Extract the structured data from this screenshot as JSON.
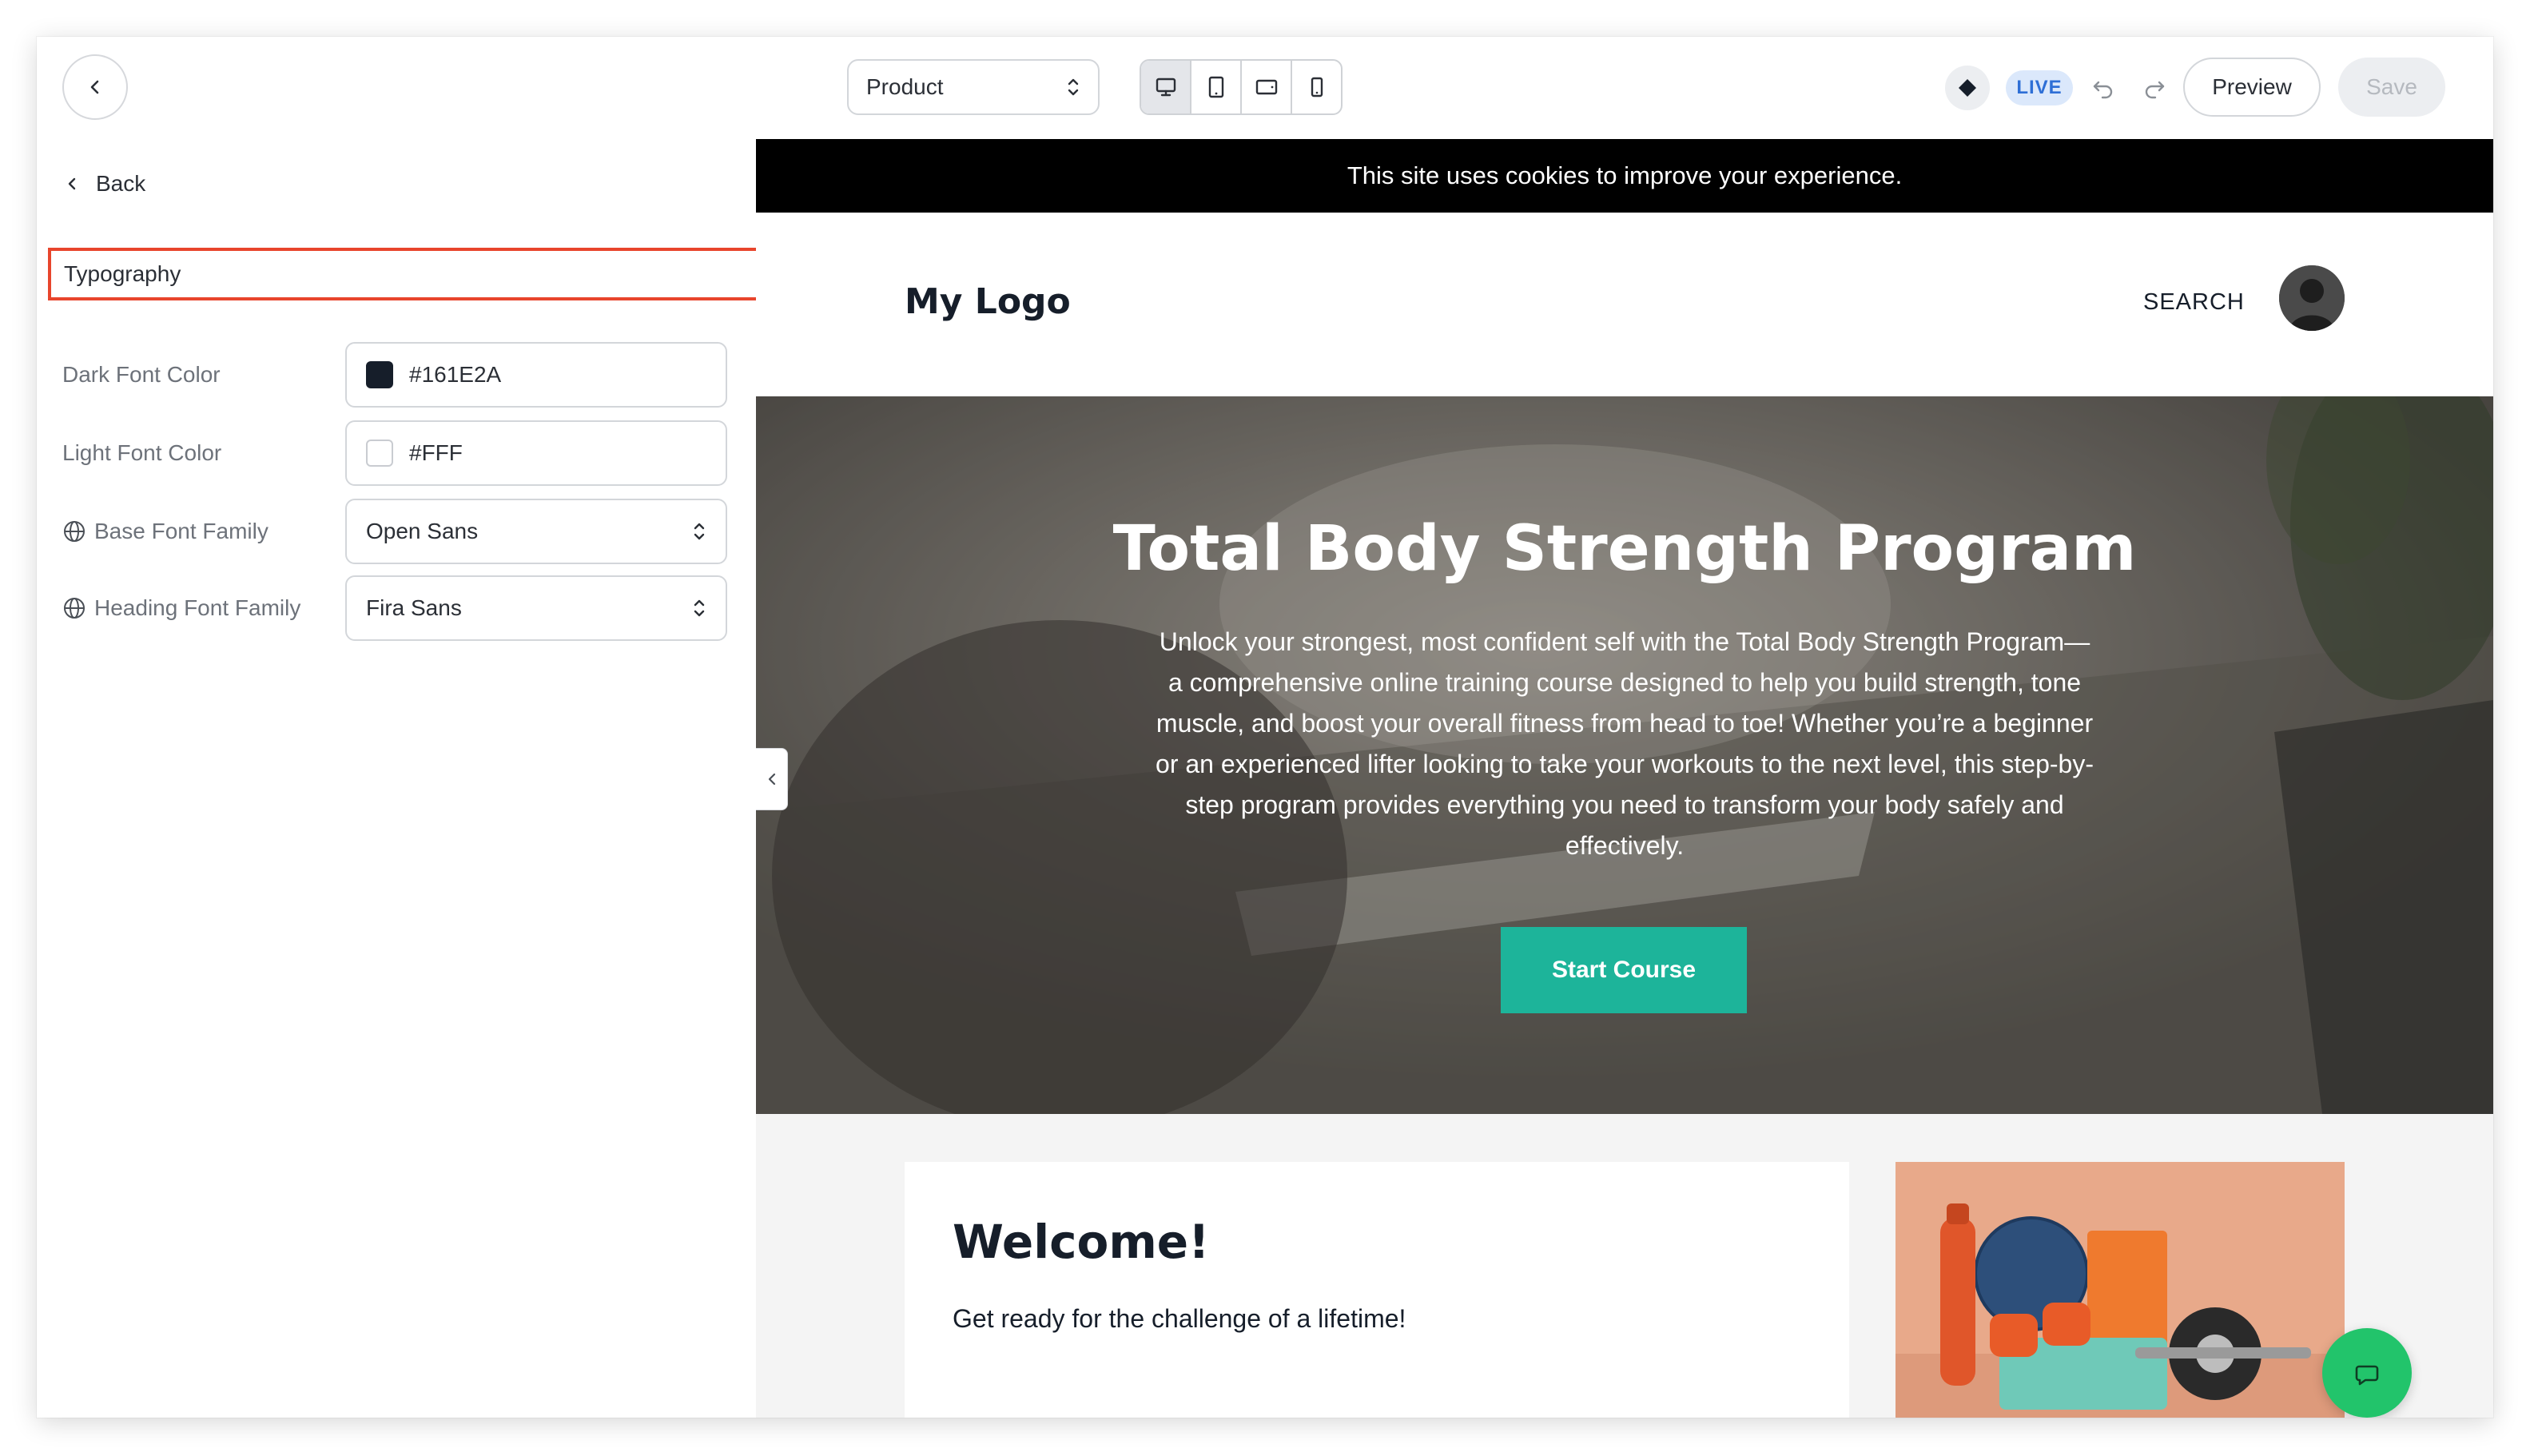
{
  "topbar": {
    "page_select": {
      "value": "Product"
    },
    "devices": [
      {
        "name": "desktop-icon",
        "active": true
      },
      {
        "name": "tablet-icon",
        "active": false
      },
      {
        "name": "tablet-landscape-icon",
        "active": false
      },
      {
        "name": "mobile-icon",
        "active": false
      }
    ],
    "status_badge": "LIVE",
    "preview_label": "Preview",
    "save_label": "Save"
  },
  "sidebar": {
    "back_label": "Back",
    "section_title": "Typography",
    "fields": {
      "dark_font_color": {
        "label": "Dark Font Color",
        "value": "#161E2A",
        "swatch": "#161E2A"
      },
      "light_font_color": {
        "label": "Light Font Color",
        "value": "#FFF",
        "swatch": "#FFFFFF"
      },
      "base_font_family": {
        "label": "Base Font Family",
        "value": "Open Sans"
      },
      "heading_font_family": {
        "label": "Heading Font Family",
        "value": "Fira Sans"
      }
    }
  },
  "preview": {
    "cookie_banner": "This site uses cookies to improve your experience.",
    "logo": "My Logo",
    "search": "SEARCH",
    "hero": {
      "title": "Total Body Strength Program",
      "body": "Unlock your strongest, most confident self with the Total Body Strength Program—a comprehensive online training course designed to help you build strength, tone muscle, and boost your overall fitness from head to toe! Whether you’re a beginner or an experienced lifter looking to take your workouts to the next level, this step-by-step program provides everything you need to transform your body safely and effectively.",
      "cta": "Start Course"
    },
    "welcome": {
      "title": "Welcome!",
      "text": "Get ready for the challenge of a lifetime!"
    }
  },
  "colors": {
    "accent_teal": "#1DB49A",
    "chat_green": "#22C46B",
    "highlight_red": "#E8452C",
    "live_blue": "#2E6FD6"
  }
}
